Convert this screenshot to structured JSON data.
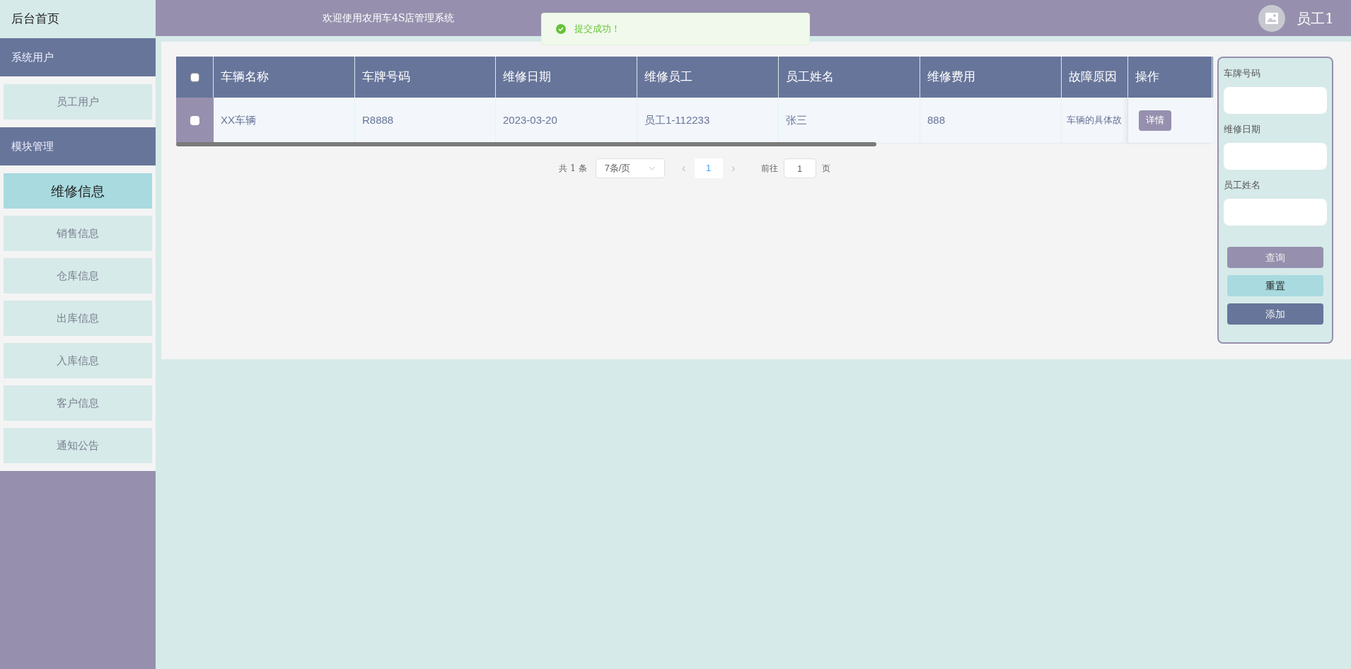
{
  "sidebar": {
    "home": "后台首页",
    "groups": [
      {
        "title": "系统用户",
        "items": [
          {
            "label": "员工用户",
            "selected": false
          }
        ]
      },
      {
        "title": "模块管理",
        "items": [
          {
            "label": "维修信息",
            "selected": true
          },
          {
            "label": "销售信息",
            "selected": false
          },
          {
            "label": "仓库信息",
            "selected": false
          },
          {
            "label": "出库信息",
            "selected": false
          },
          {
            "label": "入库信息",
            "selected": false
          },
          {
            "label": "客户信息",
            "selected": false
          },
          {
            "label": "通知公告",
            "selected": false
          }
        ]
      }
    ]
  },
  "header": {
    "title": "欢迎使用农用车4S店管理系统",
    "user": "员工1"
  },
  "toast": {
    "text": "提交成功！"
  },
  "table": {
    "select_all": {
      "checked": false
    },
    "columns": [
      "车辆名称",
      "车牌号码",
      "维修日期",
      "维修员工",
      "员工姓名",
      "维修费用",
      "故障原因",
      "操作"
    ],
    "rows": [
      {
        "checked": false,
        "cells": [
          "XX车辆",
          "R8888",
          "2023-03-20",
          "员工1-112233",
          "张三",
          "888",
          "车辆的具体故"
        ],
        "action": "详情"
      }
    ]
  },
  "pagination": {
    "total": "共 1 条",
    "page_size": "7条/页",
    "prev": "‹",
    "pages": [
      {
        "label": "1",
        "selected": true
      }
    ],
    "next": "›",
    "goto_label": "前往",
    "goto_value": "1",
    "goto_suffix": "页"
  },
  "search": {
    "fields": [
      {
        "label": "车牌号码"
      },
      {
        "label": "维修日期"
      },
      {
        "label": "员工姓名"
      }
    ],
    "buttons": [
      {
        "label": "查询",
        "kind": "query"
      },
      {
        "label": "重置",
        "kind": "reset"
      },
      {
        "label": "添加",
        "kind": "add"
      }
    ]
  }
}
